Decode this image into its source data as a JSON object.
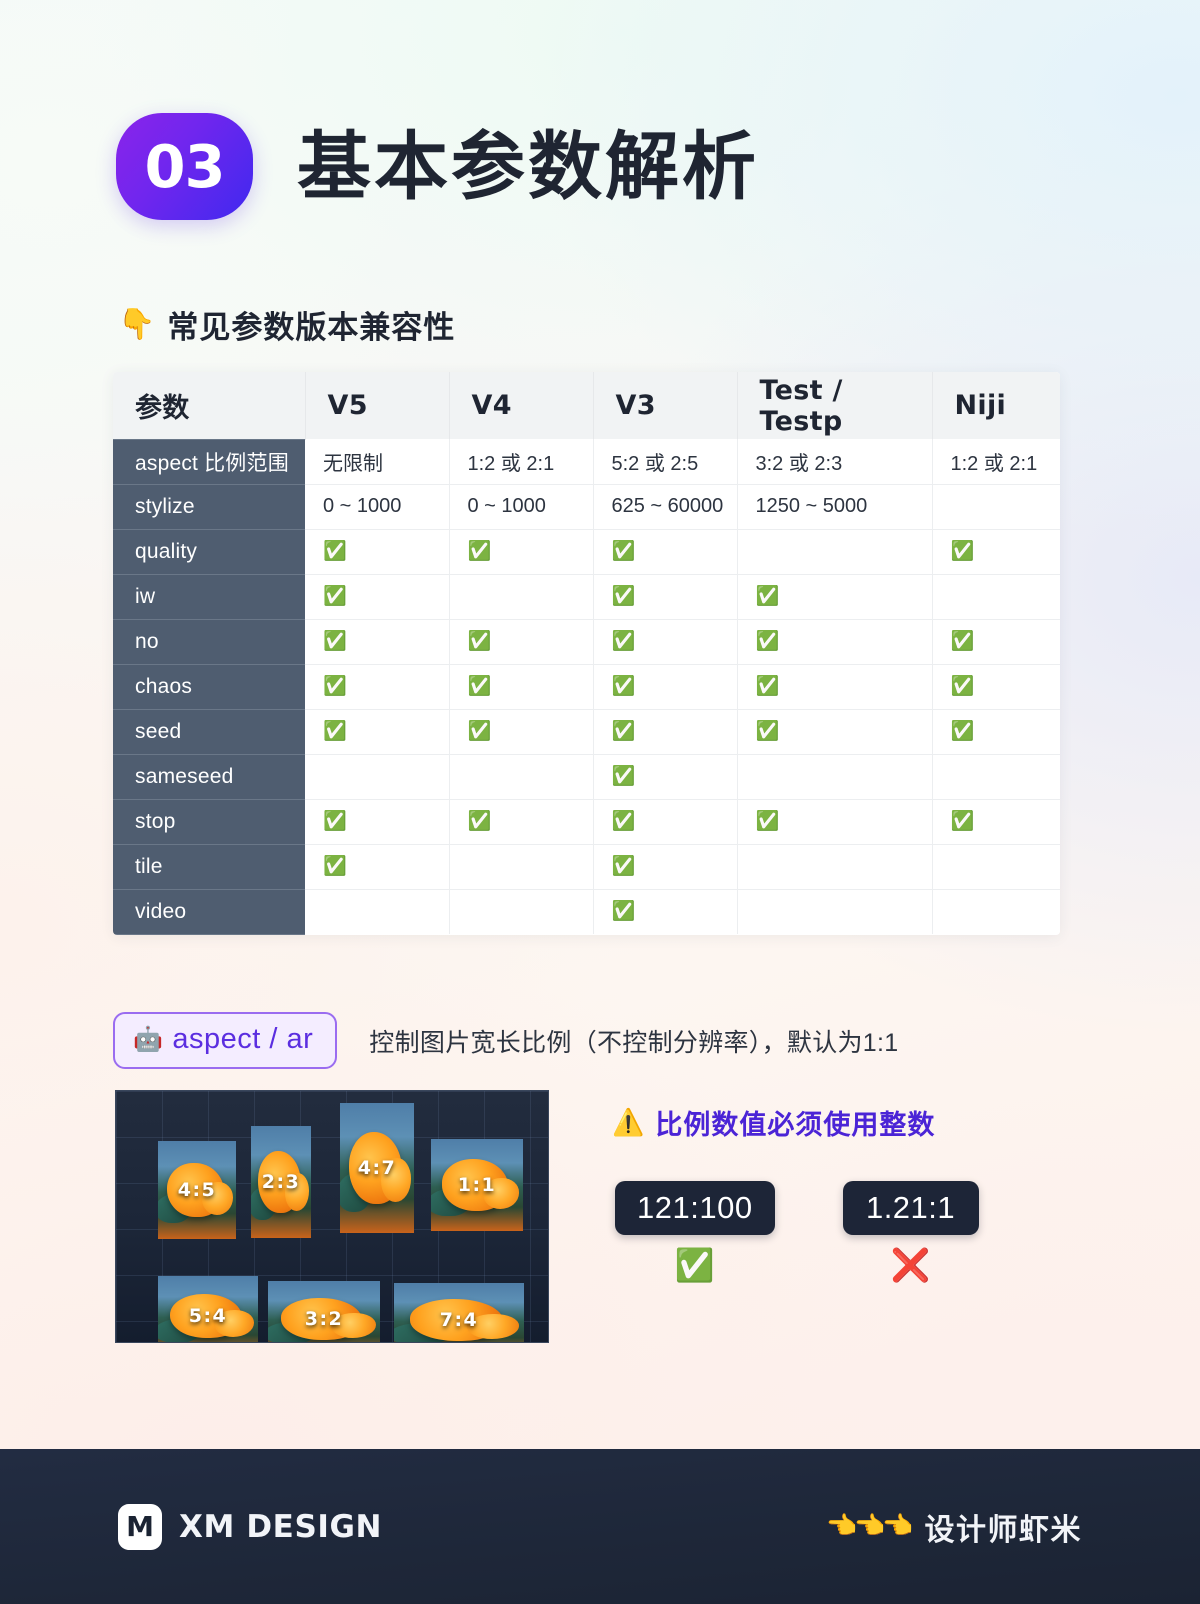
{
  "header": {
    "number": "03",
    "title": "基本参数解析"
  },
  "section": {
    "icon": "👇",
    "icon_name": "pointing-down-icon",
    "title": "常见参数版本兼容性"
  },
  "table": {
    "columns": [
      "参数",
      "V5",
      "V4",
      "V3",
      "Test / Testp",
      "Niji"
    ],
    "check_glyph": "✅",
    "rows": [
      {
        "param": "aspect 比例范围",
        "values": [
          "无限制",
          "1:2 或 2:1",
          "5:2 或 2:5",
          "3:2 或 2:3",
          "1:2 或 2:1"
        ]
      },
      {
        "param": "stylize",
        "values": [
          "0 ~ 1000",
          "0 ~ 1000",
          "625 ~ 60000",
          "1250 ~ 5000",
          ""
        ]
      },
      {
        "param": "quality",
        "values": [
          "✅",
          "✅",
          "✅",
          "",
          "✅"
        ]
      },
      {
        "param": "iw",
        "values": [
          "✅",
          "",
          "✅",
          "✅",
          ""
        ]
      },
      {
        "param": "no",
        "values": [
          "✅",
          "✅",
          "✅",
          "✅",
          "✅"
        ]
      },
      {
        "param": "chaos",
        "values": [
          "✅",
          "✅",
          "✅",
          "✅",
          "✅"
        ]
      },
      {
        "param": "seed",
        "values": [
          "✅",
          "✅",
          "✅",
          "✅",
          "✅"
        ]
      },
      {
        "param": "sameseed",
        "values": [
          "",
          "",
          "✅",
          "",
          ""
        ]
      },
      {
        "param": "stop",
        "values": [
          "✅",
          "✅",
          "✅",
          "✅",
          "✅"
        ]
      },
      {
        "param": "tile",
        "values": [
          "✅",
          "",
          "✅",
          "",
          ""
        ]
      },
      {
        "param": "video",
        "values": [
          "",
          "",
          "✅",
          "",
          ""
        ]
      }
    ]
  },
  "param_block": {
    "badge_icon": "🤖",
    "badge_icon_name": "robot-icon",
    "badge_label": "aspect / ar",
    "description": "控制图片宽长比例（不控制分辨率），默认为1:1"
  },
  "ratio_panel": {
    "row1": [
      "4:5",
      "2:3",
      "4:7",
      "1:1"
    ],
    "row2": [
      "5:4",
      "3:2",
      "7:4"
    ]
  },
  "warning": {
    "icon": "⚠️",
    "icon_name": "warning-icon",
    "text": "比例数值必须使用整数"
  },
  "examples": [
    {
      "value": "121:100",
      "mark": "✅",
      "mark_name": "valid-check-icon"
    },
    {
      "value": "1.21:1",
      "mark": "❌",
      "mark_name": "invalid-cross-icon"
    }
  ],
  "footer": {
    "logo_glyph": "M",
    "logo_text": "XM DESIGN",
    "hands": "👈👈👈",
    "author": "设计师虾米"
  },
  "colors": {
    "accent_purple": "#5b2ee0",
    "badge_gradient_from": "#8a24ea",
    "badge_gradient_to": "#4029ef",
    "row_head_bg": "#4f5d70",
    "table_head_bg": "#f1f3f4",
    "footer_bg": "#1e2739",
    "chip_bg": "#1d2537",
    "warning_text": "#4b24d6"
  }
}
